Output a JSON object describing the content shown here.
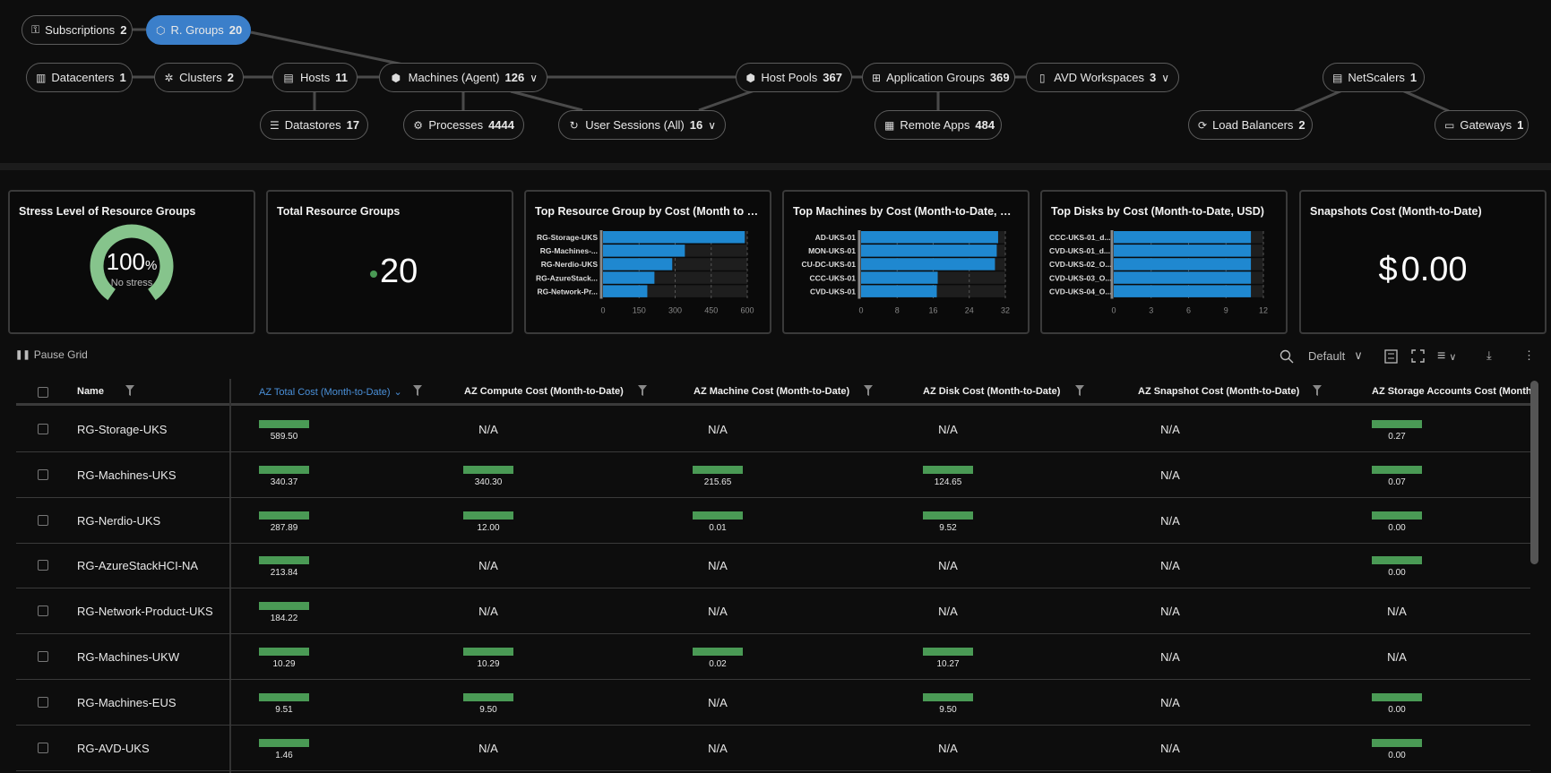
{
  "topology": {
    "nodes": [
      {
        "id": "subscriptions",
        "label": "Subscriptions",
        "count": "2",
        "icon": "key-icon",
        "active": false,
        "dropdown": false
      },
      {
        "id": "resource-groups",
        "label": "R. Groups",
        "count": "20",
        "icon": "cube-icon",
        "active": true,
        "dropdown": false
      },
      {
        "id": "datacenters",
        "label": "Datacenters",
        "count": "1",
        "icon": "building-icon",
        "active": false,
        "dropdown": false
      },
      {
        "id": "clusters",
        "label": "Clusters",
        "count": "2",
        "icon": "cluster-icon",
        "active": false,
        "dropdown": false
      },
      {
        "id": "hosts",
        "label": "Hosts",
        "count": "11",
        "icon": "server-icon",
        "active": false,
        "dropdown": false
      },
      {
        "id": "machines",
        "label": "Machines (Agent)",
        "count": "126",
        "icon": "machine-icon",
        "active": false,
        "dropdown": true
      },
      {
        "id": "datastores",
        "label": "Datastores",
        "count": "17",
        "icon": "database-icon",
        "active": false,
        "dropdown": false
      },
      {
        "id": "processes",
        "label": "Processes",
        "count": "4444",
        "icon": "gears-icon",
        "active": false,
        "dropdown": false
      },
      {
        "id": "user-sessions",
        "label": "User Sessions (All)",
        "count": "16",
        "icon": "refresh-icon",
        "active": false,
        "dropdown": true
      },
      {
        "id": "host-pools",
        "label": "Host Pools",
        "count": "367",
        "icon": "box-icon",
        "active": false,
        "dropdown": false
      },
      {
        "id": "application-groups",
        "label": "Application Groups",
        "count": "369",
        "icon": "app-grid-icon",
        "active": false,
        "dropdown": false
      },
      {
        "id": "avd-workspaces",
        "label": "AVD Workspaces",
        "count": "3",
        "icon": "workspace-icon",
        "active": false,
        "dropdown": true
      },
      {
        "id": "remote-apps",
        "label": "Remote Apps",
        "count": "484",
        "icon": "grid-icon",
        "active": false,
        "dropdown": false
      },
      {
        "id": "netscalers",
        "label": "NetScalers",
        "count": "1",
        "icon": "netscaler-icon",
        "active": false,
        "dropdown": false
      },
      {
        "id": "load-balancers",
        "label": "Load Balancers",
        "count": "2",
        "icon": "load-balancer-icon",
        "active": false,
        "dropdown": false
      },
      {
        "id": "gateways",
        "label": "Gateways",
        "count": "1",
        "icon": "gateway-icon",
        "active": false,
        "dropdown": false
      }
    ]
  },
  "cards": {
    "stress": {
      "title": "Stress Level of Resource Groups",
      "value": "100",
      "unit": "%",
      "status": "No stress",
      "percent": 100,
      "color": "#86c48c"
    },
    "total": {
      "title": "Total Resource Groups",
      "value": "20",
      "dot_color": "#4a9a55"
    },
    "snapshots": {
      "title": "Snapshots Cost (Month-to-Date)",
      "currency": "$",
      "value": "0.00"
    }
  },
  "chart_data": [
    {
      "type": "bar",
      "orientation": "horizontal",
      "title": "Top Resource Group by Cost (Month to Dat...",
      "categories": [
        "RG-Storage-UKS",
        "RG-Machines-...",
        "RG-Nerdio-UKS",
        "RG-AzureStack...",
        "RG-Network-Pr..."
      ],
      "values": [
        589.5,
        340.37,
        287.89,
        213.84,
        184.22
      ],
      "xlim": [
        0,
        600
      ],
      "ticks": [
        "0",
        "150",
        "300",
        "450",
        "600"
      ],
      "grid": true,
      "color": "#1f88d0"
    },
    {
      "type": "bar",
      "orientation": "horizontal",
      "title": "Top Machines by Cost (Month-to-Date, USD)",
      "categories": [
        "AD-UKS-01",
        "MON-UKS-01",
        "CU-DC-UKS-01",
        "CCC-UKS-01",
        "CVD-UKS-01"
      ],
      "values": [
        30.4,
        30.1,
        29.7,
        17.0,
        16.8
      ],
      "xlim": [
        0,
        32
      ],
      "ticks": [
        "0",
        "8",
        "16",
        "24",
        "32"
      ],
      "grid": true,
      "color": "#1f88d0"
    },
    {
      "type": "bar",
      "orientation": "horizontal",
      "title": "Top Disks by Cost (Month-to-Date, USD)",
      "categories": [
        "CCC-UKS-01_d...",
        "CVD-UKS-01_d...",
        "CVD-UKS-02_O...",
        "CVD-UKS-03_O...",
        "CVD-UKS-04_O..."
      ],
      "values": [
        11,
        11,
        11,
        11,
        11
      ],
      "xlim": [
        0,
        12
      ],
      "ticks": [
        "0",
        "3",
        "6",
        "9",
        "12"
      ],
      "grid": true,
      "color": "#1f88d0"
    }
  ],
  "toolbar": {
    "pause_label": "Pause Grid",
    "view_select": "Default"
  },
  "table": {
    "columns": [
      {
        "label": "Name",
        "sorted": false
      },
      {
        "label": "AZ Total Cost (Month-to-Date)",
        "sorted": true
      },
      {
        "label": "AZ Compute Cost (Month-to-Date)",
        "sorted": false
      },
      {
        "label": "AZ Machine Cost (Month-to-Date)",
        "sorted": false
      },
      {
        "label": "AZ Disk Cost (Month-to-Date)",
        "sorted": false
      },
      {
        "label": "AZ Snapshot Cost (Month-to-Date)",
        "sorted": false
      },
      {
        "label": "AZ Storage Accounts Cost (Month-to-Date)",
        "sorted": false
      }
    ],
    "rows": [
      {
        "name": "RG-Storage-UKS",
        "values": [
          "589.50",
          "N/A",
          "N/A",
          "N/A",
          "N/A",
          "0.27"
        ]
      },
      {
        "name": "RG-Machines-UKS",
        "values": [
          "340.37",
          "340.30",
          "215.65",
          "124.65",
          "N/A",
          "0.07"
        ]
      },
      {
        "name": "RG-Nerdio-UKS",
        "values": [
          "287.89",
          "12.00",
          "0.01",
          "9.52",
          "N/A",
          "0.00"
        ]
      },
      {
        "name": "RG-AzureStackHCI-NA",
        "values": [
          "213.84",
          "N/A",
          "N/A",
          "N/A",
          "N/A",
          "0.00"
        ]
      },
      {
        "name": "RG-Network-Product-UKS",
        "values": [
          "184.22",
          "N/A",
          "N/A",
          "N/A",
          "N/A",
          "N/A"
        ]
      },
      {
        "name": "RG-Machines-UKW",
        "values": [
          "10.29",
          "10.29",
          "0.02",
          "10.27",
          "N/A",
          "N/A"
        ]
      },
      {
        "name": "RG-Machines-EUS",
        "values": [
          "9.51",
          "9.50",
          "N/A",
          "9.50",
          "N/A",
          "0.00"
        ]
      },
      {
        "name": "RG-AVD-UKS",
        "values": [
          "1.46",
          "N/A",
          "N/A",
          "N/A",
          "N/A",
          "0.00"
        ]
      }
    ]
  },
  "colors": {
    "accent": "#3b7fca",
    "bar": "#1f88d0",
    "cell_bar": "#4a9a55",
    "background": "#0d0d0d"
  }
}
